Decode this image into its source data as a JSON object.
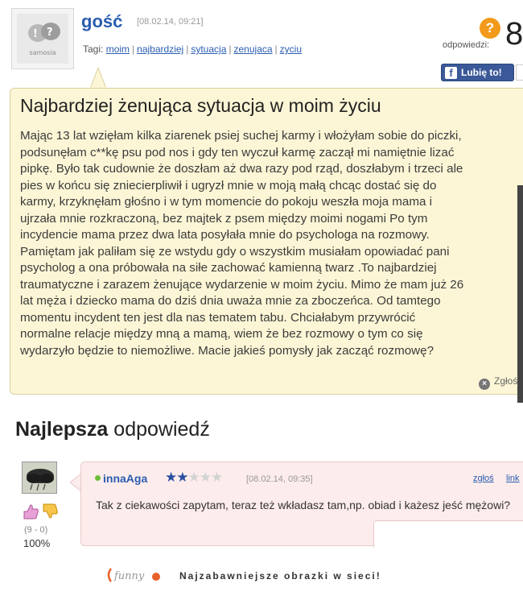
{
  "header": {
    "avatar_caption": "samosia",
    "author": "gość",
    "date": "[08.02.14, 09:21]",
    "tags_label": "Tagi:",
    "tags": [
      "moim",
      "najbardziej",
      "sytuacja",
      "zenujaca",
      "zyciu"
    ],
    "answers_icon": "?",
    "answers_label": "odpowiedzi:",
    "answers_count": "8",
    "like_label": "Lubię to!"
  },
  "question": {
    "title": "Najbardziej żenująca sytuacja w moim życiu",
    "body_lines": [
      "Mając 13 lat wzięłam kilka ziarenek psiej suchej karmy i włożyłam sobie do piczki,",
      "podsunęłam c**kę psu pod nos i gdy ten wyczuł karmę zaczął mi namiętnie lizać",
      "pipkę. Było tak cudownie że doszłam aż dwa razy pod rząd, doszłabym i trzeci ale",
      "pies w końcu się zniecierpliwił i ugryzł mnie w moją małą chcąc dostać się do",
      "karmy, krzyknęłam głośno i w tym momencie do pokoju weszła moja mama i",
      "ujrzała mnie rozkraczoną, bez majtek z psem między moimi nogami Po tym",
      "incydencie mama przez dwa lata posyłała mnie do psychologa na rozmowy.",
      "Pamiętam jak paliłam się ze wstydu gdy o wszystkim musiałam opowiadać pani",
      "psycholog a ona próbowała na siłe zachować kamienną twarz .To najbardziej",
      "traumatyczne i zarazem żenujące wydarzenie w moim życiu. Mimo że mam już 26",
      "lat męża i dziecko mama do dziś dnia uważa mnie za zboczeńca. Od tamtego",
      "momentu incydent ten jest dla nas tematem tabu. Chciałabym przywrócić",
      "normalne relacje między mną a mamą, wiem że bez rozmowy o tym co się",
      "wydarzyło będzie to niemożliwe. Macie jakieś pomysły jak zacząć rozmowę?"
    ],
    "report_label": "Zgłoś"
  },
  "best_answer": {
    "heading_bold": "Najlepsza",
    "heading_rest": " odpowiedź",
    "votes": "(9 - 0)",
    "percent": "100%",
    "user": "innaAga",
    "stars": 2,
    "stars_max": 5,
    "star_glyph": "★",
    "date": "[08.02.14, 09:35]",
    "report_label": "zgłoś",
    "link_label": "link",
    "text": "Tak z ciekawości zapytam, teraz też wkładasz tam,np. obiad i każesz jeść mężowi?"
  },
  "footer": {
    "tagline": "Najzabawniejsze obrazki w sieci!",
    "logo_text": "funny"
  },
  "colors": {
    "link_blue": "#2a5db0",
    "card_bg": "#fdf6d6",
    "answer_bg": "#fdecec",
    "facebook": "#3b5998",
    "orange": "#f39a1b"
  }
}
